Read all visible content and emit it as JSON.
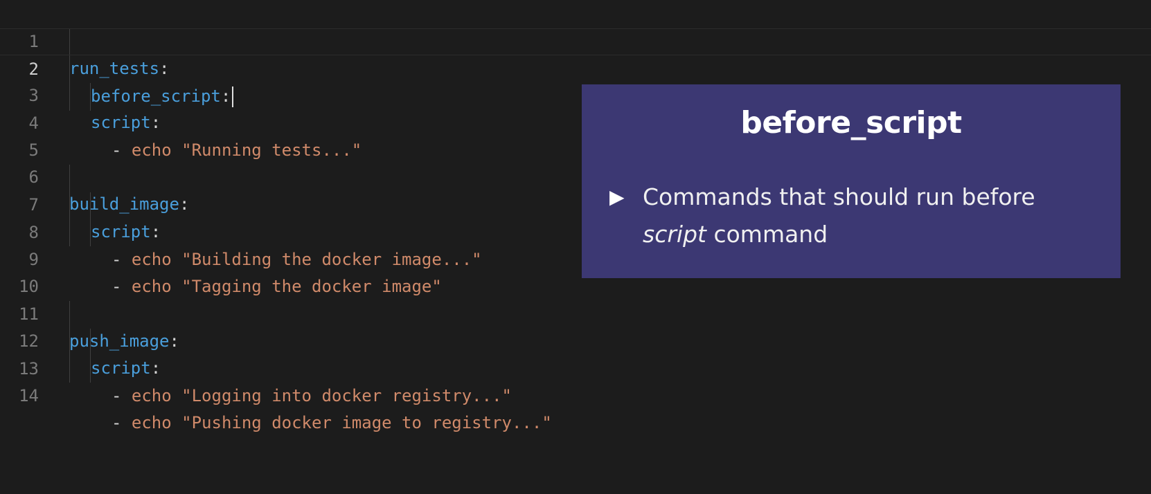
{
  "editor": {
    "lines": [
      {
        "num": "1",
        "key": "run_tests"
      },
      {
        "num": "2",
        "key": "before_script"
      },
      {
        "num": "3",
        "key": "script"
      },
      {
        "num": "4",
        "dash": "- ",
        "str": "echo \"Running tests...\""
      },
      {
        "num": "5"
      },
      {
        "num": "6",
        "key": "build_image"
      },
      {
        "num": "7",
        "key": "script"
      },
      {
        "num": "8",
        "dash": "- ",
        "str": "echo \"Building the docker image...\""
      },
      {
        "num": "9",
        "dash": "- ",
        "str": "echo \"Tagging the docker image\""
      },
      {
        "num": "10"
      },
      {
        "num": "11",
        "key": "push_image"
      },
      {
        "num": "12",
        "key": "script"
      },
      {
        "num": "13",
        "dash": "- ",
        "str": "echo \"Logging into docker registry...\""
      },
      {
        "num": "14",
        "dash": "- ",
        "str": "echo \"Pushing docker image to registry...\""
      }
    ],
    "colon": ":"
  },
  "overlay": {
    "title": "before_script",
    "bullet_icon": "play-triangle-icon",
    "bullet_glyph": "▶",
    "text_before": "Commands that should run before",
    "text_italic": "script",
    "text_after": " command"
  },
  "colors": {
    "background": "#1c1c1c",
    "key": "#4a9fdc",
    "string": "#d08a6a",
    "overlay_bg": "#3c3873"
  }
}
